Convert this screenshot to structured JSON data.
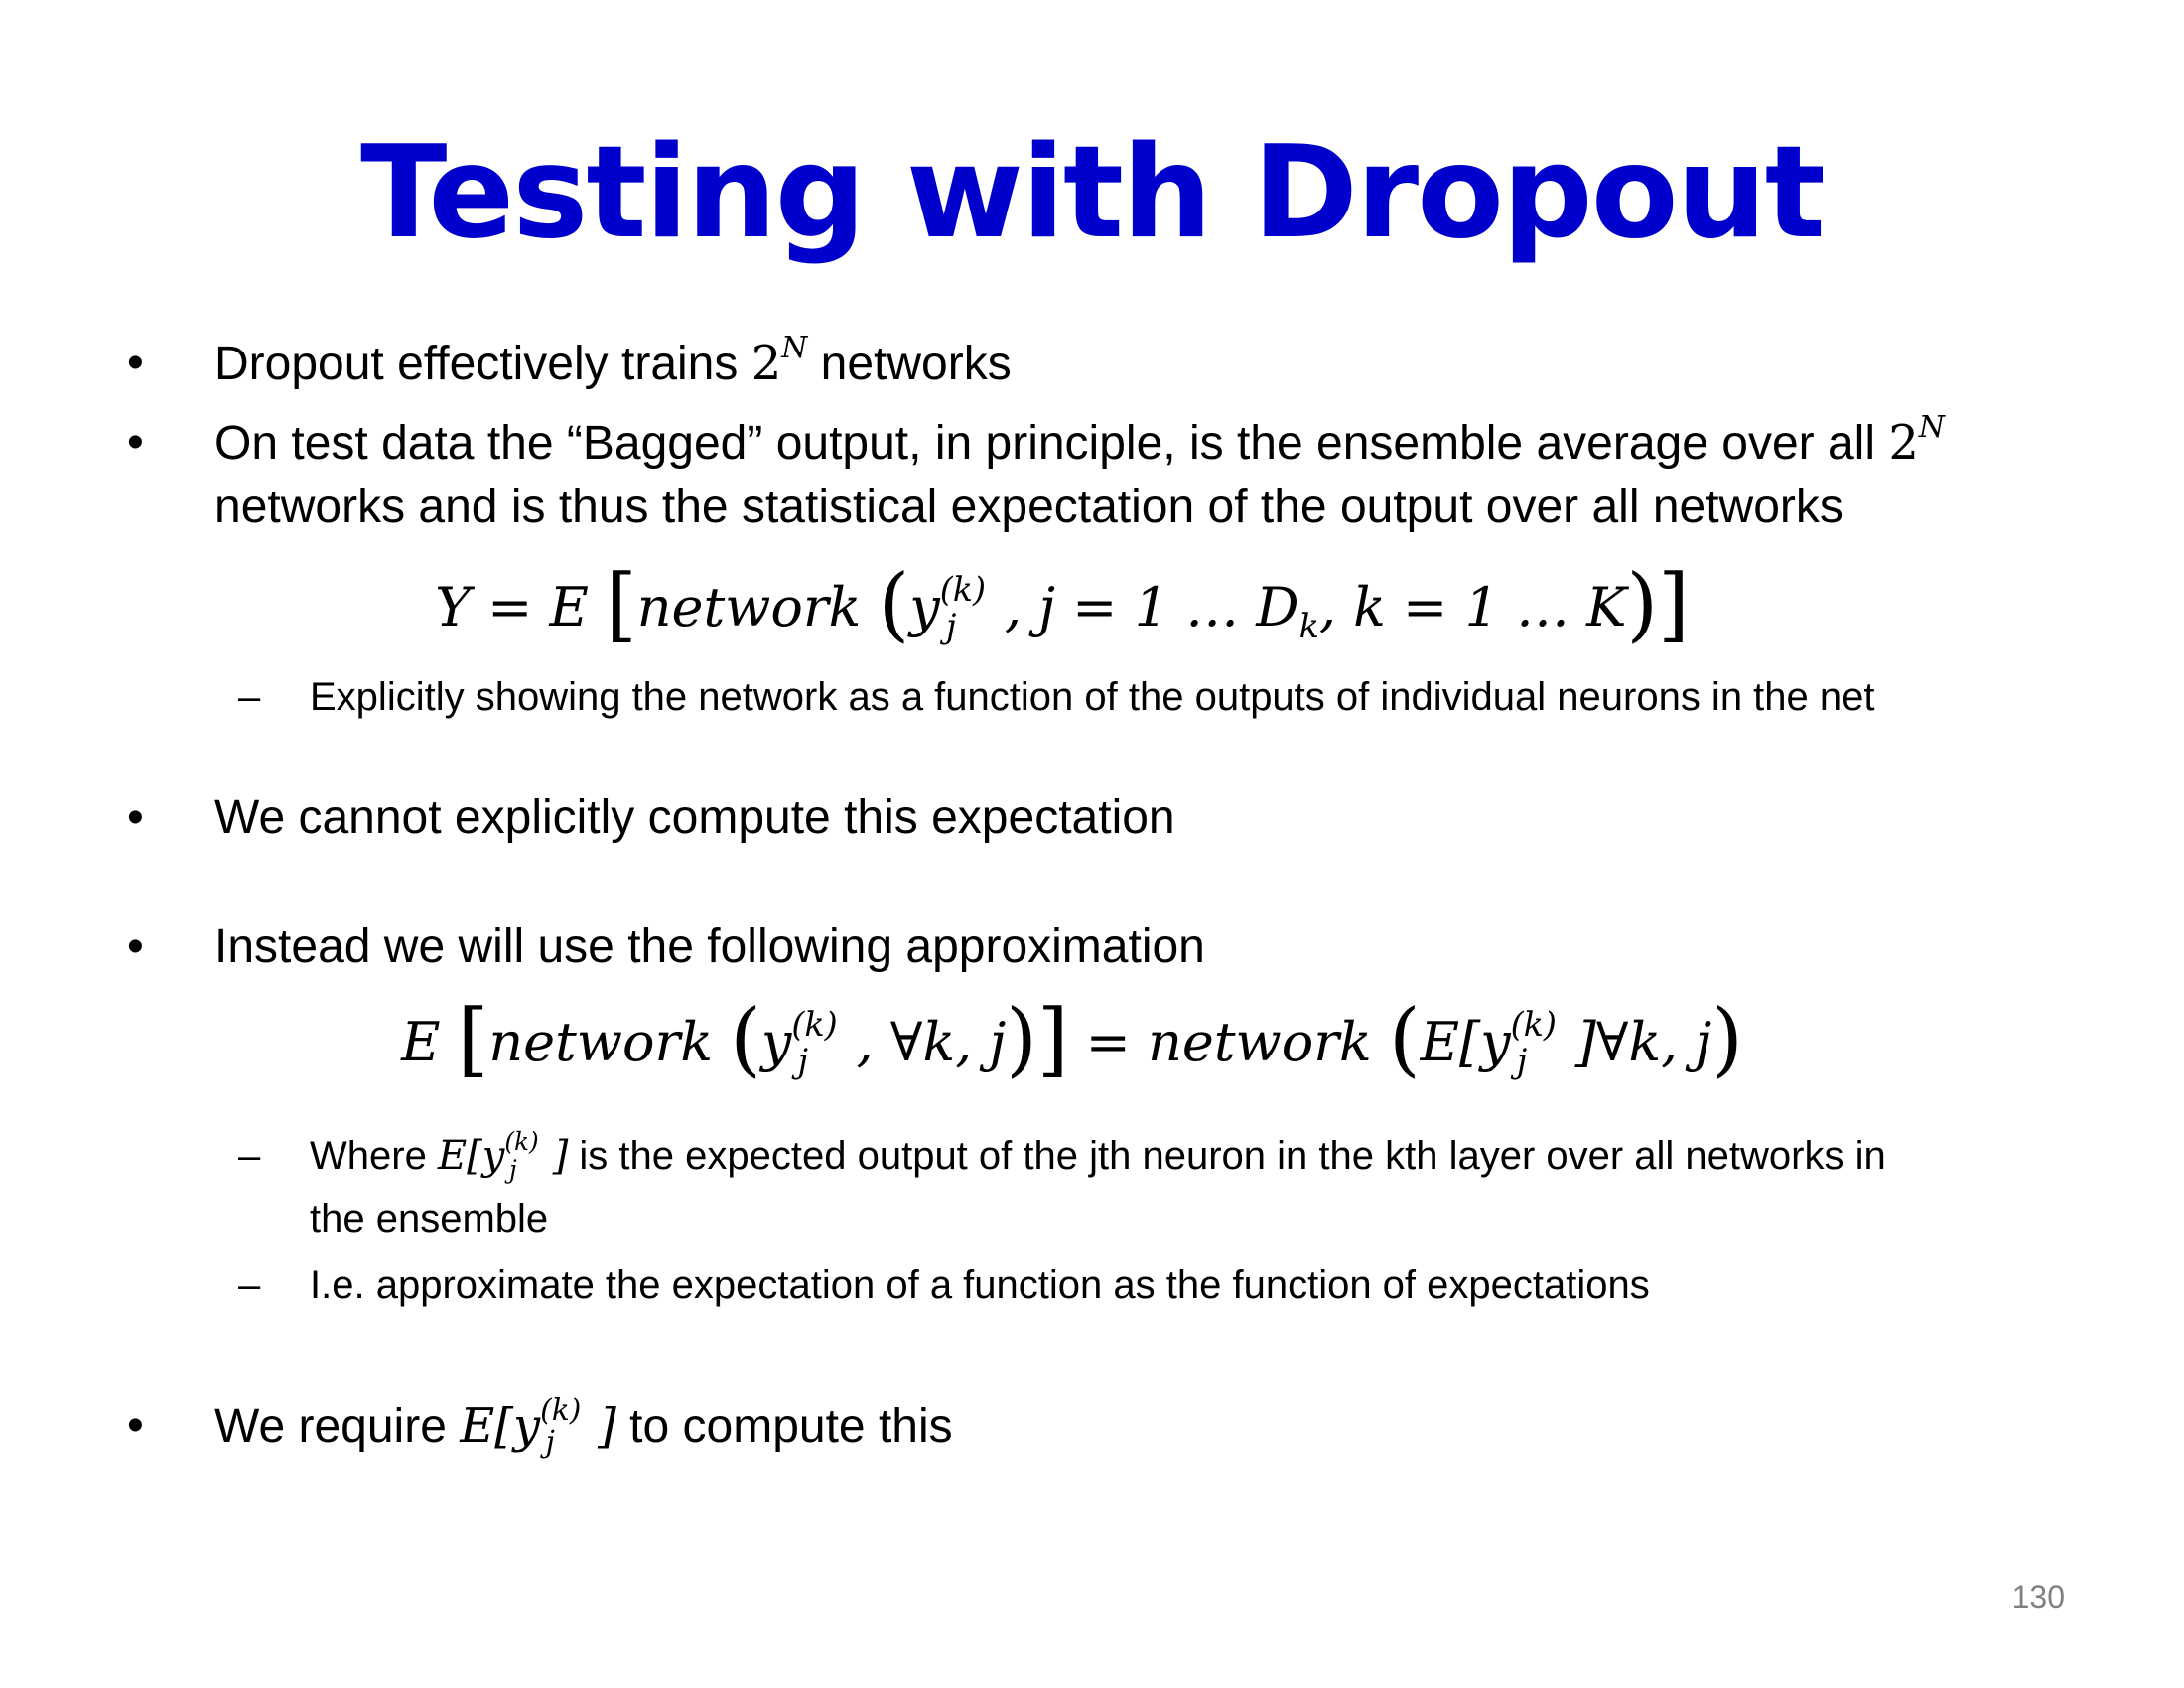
{
  "slide": {
    "title": "Testing with Dropout",
    "page_number": "130",
    "bullet_glyph": "•",
    "dash_glyph": "–",
    "b1_text": "Dropout effectively trains ",
    "b1_base": "2",
    "b1_exp": "N",
    "b1_after": " networks",
    "b2_text_line1": "On test data the “Bagged” output, in principle, is the ensemble average over all ",
    "b2_base": "2",
    "b2_exp": "N",
    "b2_text_line2": "networks and is thus the statistical expectation of the output over all networks",
    "eq1": {
      "lhs": "Y = E ",
      "lbrack": "[",
      "fn": "network ",
      "lparen": "(",
      "y": "y",
      "y_sup": "(k)",
      "y_sub": "j",
      "mid": ", j = 1 … D",
      "d_sub": "k",
      "tail": ", k = 1 … K",
      "rparen": ")",
      "rbrack": "]"
    },
    "sub1": "Explicitly showing the network as a function of the outputs of individual neurons in the net",
    "b3": "We cannot explicitly compute this expectation",
    "b4": "Instead we will use the following approximation",
    "eq2": {
      "E": "E ",
      "lbrack": "[",
      "fn": "network ",
      "lparen": "(",
      "y": "y",
      "y_sup": "(k)",
      "y_sub": "j",
      "args": ", ∀k, j",
      "rparen": ")",
      "rbrack": "]",
      "eq": " = ",
      "fn2": "network ",
      "lparen2": "(",
      "E2": "E[",
      "y2": "y",
      "y2_sup": "(k)",
      "y2_sub": "j",
      "close2": "]∀k, j",
      "rparen2": ")"
    },
    "sub2_before": "Where ",
    "sub2_E": "E[",
    "sub2_y": "y",
    "sub2_sup": "(k)",
    "sub2_sub": "j",
    "sub2_close": "]",
    "sub2_after_line1": " is the expected output of the jth neuron in the kth layer over all networks in",
    "sub2_line2": "the ensemble",
    "sub3": "I.e. approximate the expectation of a function as the function of expectations",
    "b5_before": "We require ",
    "b5_E": "E[",
    "b5_y": "y",
    "b5_sup": "(k)",
    "b5_sub": "j",
    "b5_close": "]",
    "b5_after": " to compute this"
  }
}
